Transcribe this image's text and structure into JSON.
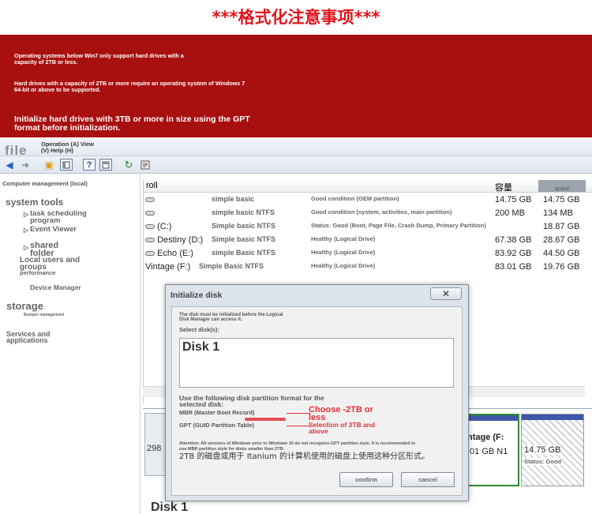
{
  "header": {
    "title": "***格式化注意事项***"
  },
  "banner": {
    "line1": "Operating systems below Win7 only support hard drives with a capacity of 2TB or less.",
    "line2": "Hard drives with a capacity of 2TB or more require an operating system of Windows 7 64-bit or above to be supported.",
    "line3": "Initialize hard drives with 3TB or more in size using the GPT format before initialization."
  },
  "window": {
    "menu": {
      "file": "file",
      "operation_view": "Operation (A) View",
      "help": "(V) Help (H)"
    },
    "toolbar_icons": [
      "back-arrow-icon",
      "forward-arrow-icon",
      "folder-icon",
      "view-icon",
      "help-icon",
      "panel-icon",
      "refresh-icon",
      "properties-icon"
    ]
  },
  "tree": {
    "root": "Computer management (local)",
    "system_tools": "system tools",
    "task_scheduling": "task scheduling program",
    "event_viewer": "Event Viewer",
    "shared_folder": "shared folder",
    "local_users": "Local users and groups",
    "performance": "performance",
    "device_manager": "Device Manager",
    "storage": "storage",
    "bumper": "Bumper management",
    "services": "Services and applications"
  },
  "volume_list": {
    "columns": {
      "roll": "roll",
      "capacity": "容量",
      "free": "space"
    },
    "rows": [
      {
        "drive": "",
        "layout": "simple basic",
        "status": "Good condition (OEM partition)",
        "capacity": "14.75 GB",
        "free": "14.75 GB"
      },
      {
        "drive": "",
        "layout": "simple basic NTFS",
        "status": "Good condition (system, activities, main partition)",
        "capacity": "200 MB",
        "free": "134 MB"
      },
      {
        "drive": "(C:)",
        "layout": "Simple basic NTFS",
        "status": "Status: Good (Boot, Page File, Crash Dump, Primary Partition)",
        "capacity": "",
        "free": "18.87 GB"
      },
      {
        "drive": "Destiny (D:)",
        "layout": "Simple basic NTFS",
        "status": "Healthy (Logical Drive)",
        "capacity": "67.38 GB",
        "free": "28.67 GB"
      },
      {
        "drive": "Echo (E:)",
        "layout": "simple Basic NTFS",
        "status": "Healthy (Logical Drive)",
        "capacity": "83.92 GB",
        "free": "44.50 GB"
      },
      {
        "drive": "Vintage (F:)",
        "layout": "Simple Basic NTFS",
        "status": "Healthy (Logical Drive)",
        "capacity": "83.01 GB",
        "free": "19.76 GB"
      }
    ]
  },
  "lower_pane": {
    "part_a_line1": "ntage (F:",
    "part_a_line2": ".01 GB N1",
    "part_b_size": "14.75 GB",
    "part_b_status": "Status: Good",
    "disk1_label": "Disk 1",
    "left_num": "298"
  },
  "dialog": {
    "title": "Initialize disk",
    "close_label": "✕",
    "intro": "The disk must be initialized before the Logical Disk Manager can access it.",
    "select_label": "Select disk(s):",
    "disk_item": "Disk 1",
    "partition_heading": "Use the following disk partition format for the selected disk:",
    "mbr_label": "MBR (Master Boot Record)",
    "gpt_label": "GPT (GUID Partition Table)",
    "choose_2tb": "Choose -2TB or less",
    "select_3tb": "Selection of 3TB and above",
    "attention": "Attention: All versions of Windows prior to Windows 10 do not recognize GPT partition style. It is recommended to use MBR partition style for disks smaller than 2TB.",
    "zh_note": "2TB 的磁盘或用于 Itanium 的计算机使用的磁盘上使用这种分区形式。",
    "confirm_label": "confirm",
    "cancel_label": "cancel"
  }
}
